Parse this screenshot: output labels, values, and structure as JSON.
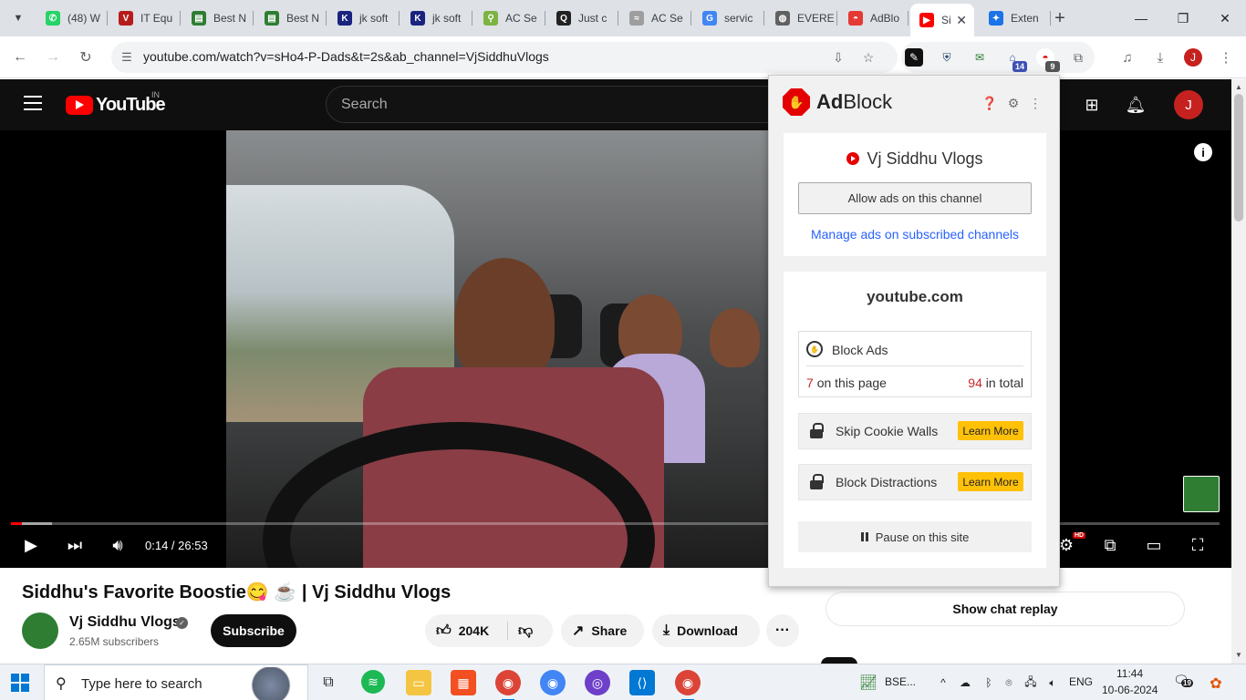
{
  "browser": {
    "tabs": [
      {
        "label": "(48) W",
        "fav_color": "#25d366",
        "fav_glyph": "✆"
      },
      {
        "label": "IT Equ",
        "fav_color": "#b71c1c",
        "fav_glyph": "V"
      },
      {
        "label": "Best N",
        "fav_color": "#2e7d32",
        "fav_glyph": "▤"
      },
      {
        "label": "Best N",
        "fav_color": "#2e7d32",
        "fav_glyph": "▤"
      },
      {
        "label": "jk soft",
        "fav_color": "#1a237e",
        "fav_glyph": "K"
      },
      {
        "label": "jk soft",
        "fav_color": "#1a237e",
        "fav_glyph": "K"
      },
      {
        "label": "AC Se",
        "fav_color": "#7cb342",
        "fav_glyph": "⚲"
      },
      {
        "label": "Just c",
        "fav_color": "#222222",
        "fav_glyph": "Q"
      },
      {
        "label": "AC Se",
        "fav_color": "#9e9e9e",
        "fav_glyph": "≈"
      },
      {
        "label": "servic",
        "fav_color": "#4285f4",
        "fav_glyph": "G"
      },
      {
        "label": "EVERE",
        "fav_color": "#616161",
        "fav_glyph": "◍"
      },
      {
        "label": "AdBlo",
        "fav_color": "#e53935",
        "fav_glyph": "◓"
      },
      {
        "label": "Si",
        "fav_color": "#ff0000",
        "fav_glyph": "▶",
        "active": true
      },
      {
        "label": "Exten",
        "fav_color": "#1a73e8",
        "fav_glyph": "✦"
      }
    ],
    "url": "youtube.com/watch?v=sHo4-P-Dads&t=2s&ab_channel=VjSiddhuVlogs",
    "extension_badges": {
      "ext4": "14",
      "adblock": "9"
    },
    "profile_initial": "J"
  },
  "youtube": {
    "logo_text": "YouTube",
    "region": "IN",
    "search_placeholder": "Search",
    "avatar_initial": "J",
    "player": {
      "time": "0:14 / 26:53",
      "played_fraction": 0.0088,
      "buffered_fraction": 0.034,
      "quality_badge": "HD"
    },
    "title": "Siddhu's Favorite Boostie😋 ☕ | Vj Siddhu Vlogs",
    "channel_name": "Vj Siddhu Vlogs",
    "subscribers": "2.65M subscribers",
    "subscribe_label": "Subscribe",
    "likes": "204K",
    "share_label": "Share",
    "download_label": "Download",
    "chat_replay_label": "Show chat replay"
  },
  "adblock": {
    "brand_ad": "Ad",
    "brand_block": "Block",
    "channel": "Vj Siddhu Vlogs",
    "allow_button": "Allow ads on this channel",
    "manage_link": "Manage ads on subscribed channels",
    "domain": "youtube.com",
    "block_ads_label": "Block Ads",
    "page_count": "7",
    "page_count_suffix": "on this page",
    "total_count": "94",
    "total_count_suffix": "in total",
    "skip_cookie_label": "Skip Cookie Walls",
    "block_distractions_label": "Block Distractions",
    "learn_more": "Learn More",
    "pause_label": "Pause on this site"
  },
  "taskbar": {
    "search_placeholder": "Type here to search",
    "stock_label": "BSE...",
    "language": "ENG",
    "time": "11:44",
    "date": "10-06-2024",
    "notification_count": "19"
  }
}
